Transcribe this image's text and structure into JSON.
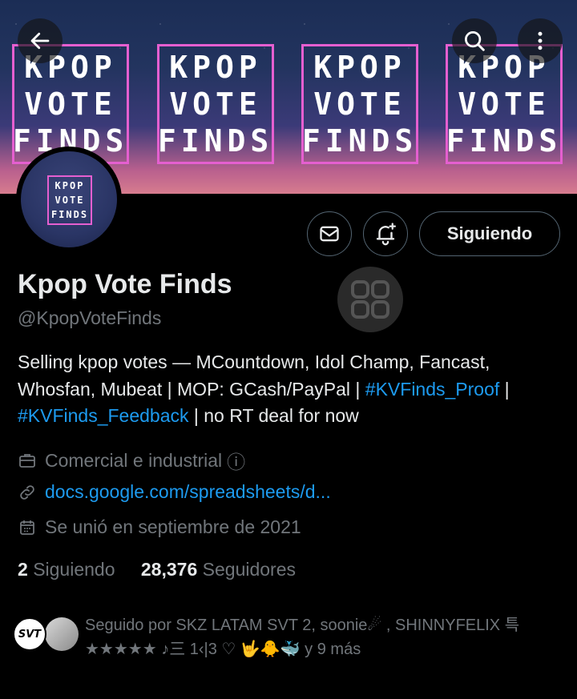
{
  "banner": {
    "tiles": [
      {
        "l1": "KPOP",
        "l2": "VOTE",
        "l3": "FINDS"
      },
      {
        "l1": "KPOP",
        "l2": "VOTE",
        "l3": "FINDS"
      },
      {
        "l1": "KPOP",
        "l2": "VOTE",
        "l3": "FINDS"
      },
      {
        "l1": "KPOP",
        "l2": "VOTE",
        "l3": "FINDS"
      }
    ]
  },
  "nav": {
    "back_icon": "arrow-left-icon",
    "search_icon": "search-icon",
    "more_icon": "more-vertical-icon"
  },
  "avatar": {
    "l1": "KPOP",
    "l2": "VOTE",
    "l3": "FINDS"
  },
  "actions": {
    "message_icon": "mail-icon",
    "notify_icon": "bell-plus-icon",
    "follow_label": "Siguiendo"
  },
  "profile": {
    "name": "Kpop Vote Finds",
    "handle": "@KpopVoteFinds",
    "bio_1": "Selling kpop votes — MCountdown, Idol Champ, Fancast, Whosfan, Mubeat | MOP: GCash/PayPal | ",
    "bio_tag_1": "#KVFinds_Proof",
    "bio_2": " | ",
    "bio_tag_2": "#KVFinds_Feedback",
    "bio_3": " | no RT deal for now",
    "category": "Comercial e industrial",
    "category_info": "ⓘ",
    "url": "docs.google.com/spreadsheets/d...",
    "joined": "Se unió en septiembre de 2021"
  },
  "stats": {
    "following_count": "2",
    "following_label": "Siguiendo",
    "followers_count": "28,376",
    "followers_label": "Seguidores"
  },
  "followed_by": {
    "text_line1": "Seguido por SKZ LATAM SVT 2, soonie☄ , SHINNYFELIX 특",
    "text_line2": "★★★★★ ♪三 1‹|3 ♡ 🤟🐥🐳 y 9 más",
    "avatar1_text": "SVT"
  },
  "colors": {
    "accent": "#1d9bf0",
    "muted": "#71767b",
    "text": "#e7e9ea",
    "border": "#536471",
    "tile_border": "#e55fd0"
  }
}
